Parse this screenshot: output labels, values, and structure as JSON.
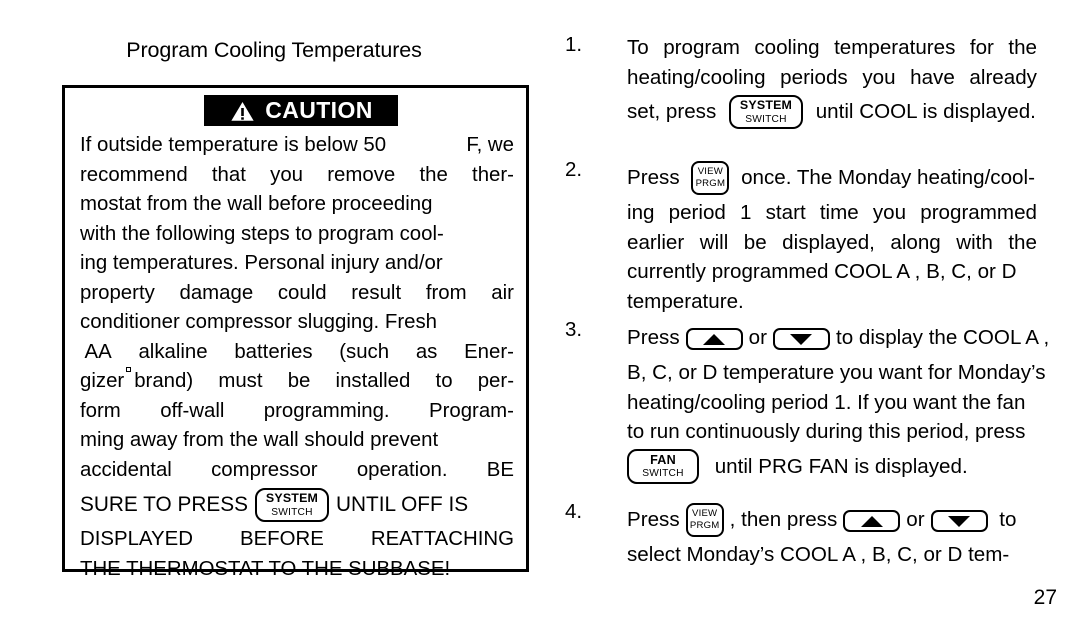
{
  "page": {
    "number": "27"
  },
  "left": {
    "section_title": "Program Cooling Temperatures",
    "caution": {
      "banner_label": "CAUTION",
      "warning_icon": "warning-triangle-icon",
      "body_lines": [
        {
          "segments": [
            "If outside temperature is below 50",
            "F, we"
          ],
          "justified": true
        },
        {
          "segments": [
            "recommend",
            "that",
            "you",
            "remove",
            "the",
            "ther-"
          ],
          "justified": true
        },
        {
          "segments": [
            "mostat from the wall before proceeding"
          ],
          "justified": false
        },
        {
          "segments": [
            "with the following steps to program cool-"
          ],
          "justified": false
        },
        {
          "segments": [
            "ing temperatures. Personal injury and/or"
          ],
          "justified": false
        },
        {
          "segments": [
            "property",
            "damage",
            "could",
            "result",
            "from",
            "air"
          ],
          "justified": true
        },
        {
          "segments": [
            "conditioner compressor slugging. Fresh"
          ],
          "justified": false
        },
        {
          "segments": [
            " AA",
            "alkaline",
            "batteries",
            "(such",
            "as",
            "Ener-"
          ],
          "justified": true
        }
      ],
      "gizer_prefix": "gizer",
      "reg_mark": "registered-mark-icon",
      "gizer_rest_segments": [
        "brand)",
        "must",
        "be",
        "installed",
        "to",
        "per-"
      ],
      "body_lines_2": [
        {
          "segments": [
            "form",
            "off-wall",
            "programming.",
            "Program-"
          ],
          "justified": true
        },
        {
          "segments": [
            "ming away from the wall should prevent"
          ],
          "justified": false
        },
        {
          "segments": [
            "accidental",
            "compressor",
            "operation.",
            "BE"
          ],
          "justified": true
        }
      ],
      "press_line": {
        "before": "SURE TO PRESS",
        "button": {
          "name": "system-switch-button",
          "top": "SYSTEM",
          "bottom": "SWITCH"
        },
        "after": "UNTIL OFF IS"
      },
      "body_lines_3": [
        {
          "segments": [
            "DISPLAYED",
            "BEFORE",
            "REATTACHING"
          ],
          "justified": true
        },
        {
          "segments": [
            "THE THERMOSTAT TO THE SUBBASE!"
          ],
          "justified": false
        }
      ]
    }
  },
  "right": {
    "steps": [
      {
        "number": "1.",
        "lines": [
          {
            "type": "text",
            "segments": [
              "To",
              "program",
              "cooling",
              "temperatures",
              "for",
              "the"
            ],
            "justified": true
          },
          {
            "type": "text",
            "segments": [
              "heating/cooling",
              "periods",
              "you",
              "have",
              "already"
            ],
            "justified": true
          },
          {
            "type": "button",
            "before": "set, press",
            "button": {
              "name": "system-switch-button",
              "kind": "system",
              "top": "SYSTEM",
              "bottom": "SWITCH"
            },
            "after": "until COOL is displayed."
          }
        ]
      },
      {
        "number": "2.",
        "lines": [
          {
            "type": "button",
            "before": "Press",
            "button": {
              "name": "view-prgm-button",
              "kind": "view",
              "top": "VIEW",
              "bottom": "PRGM"
            },
            "after": "once. The Monday heating/cool-"
          },
          {
            "type": "text",
            "segments": [
              "ing",
              "period",
              "1",
              "start",
              "time",
              "you",
              "programmed"
            ],
            "justified": true
          },
          {
            "type": "text",
            "segments": [
              "earlier",
              "will",
              "be",
              "displayed,",
              "along",
              "with",
              "the"
            ],
            "justified": true
          },
          {
            "type": "text",
            "segments": [
              "currently programmed COOL A , B, C, or D"
            ],
            "justified": false
          },
          {
            "type": "text",
            "segments": [
              "temperature."
            ],
            "justified": false
          }
        ]
      },
      {
        "number": "3.",
        "lines": [
          {
            "type": "arrows",
            "before": "Press",
            "up": "up-arrow-button",
            "mid": "or",
            "down": "down-arrow-button",
            "after": "to display the COOL A ,"
          },
          {
            "type": "text",
            "segments": [
              "B, C, or D temperature you want for Monday’s"
            ],
            "justified": false
          },
          {
            "type": "text",
            "segments": [
              "heating/cooling period 1. If you want the fan"
            ],
            "justified": false
          },
          {
            "type": "text",
            "segments": [
              "to run continuously during this period, press"
            ],
            "justified": false
          },
          {
            "type": "button",
            "before": "",
            "button": {
              "name": "fan-switch-button",
              "kind": "fan",
              "top": "FAN",
              "bottom": "SWITCH"
            },
            "after": "until PRG FAN is displayed."
          }
        ]
      },
      {
        "number": "4.",
        "lines": [
          {
            "type": "mixed",
            "before": "Press",
            "button": {
              "name": "view-prgm-button",
              "kind": "view",
              "top": "VIEW",
              "bottom": "PRGM"
            },
            "mid1": ", then press",
            "up": "up-arrow-button",
            "mid2": "or",
            "down": "down-arrow-button",
            "after": "to"
          },
          {
            "type": "text",
            "segments": [
              "select Monday’s COOL A , B, C, or D tem-"
            ],
            "justified": false
          }
        ]
      }
    ]
  }
}
